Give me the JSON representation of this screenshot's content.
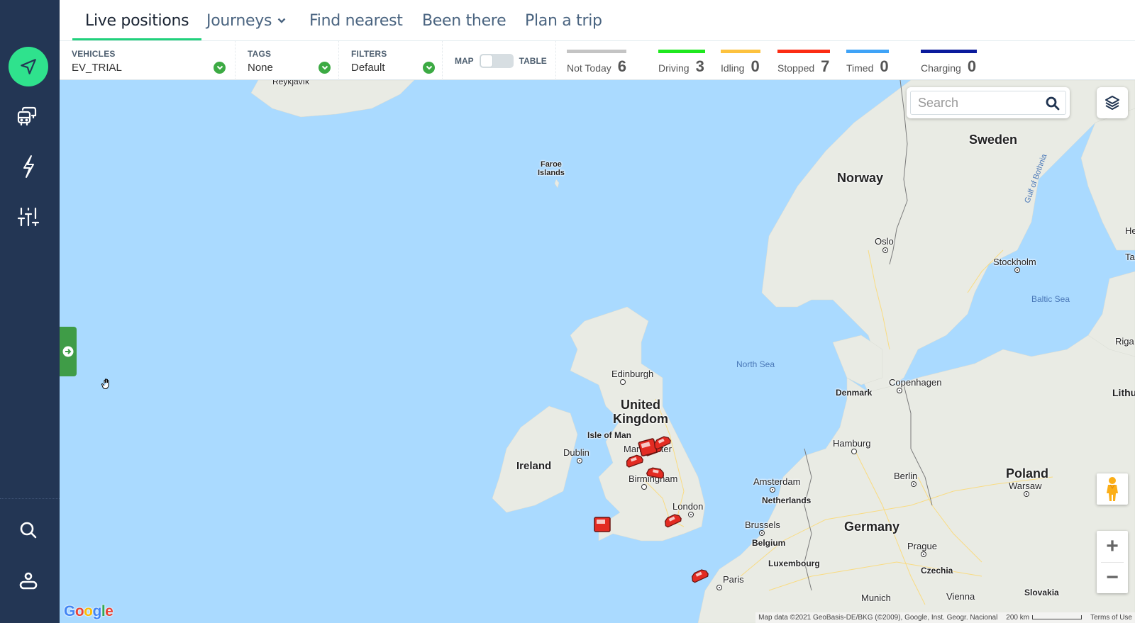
{
  "sidebar": {
    "items": [
      {
        "icon": "navigation-arrow-icon",
        "active": true
      },
      {
        "icon": "vehicles-icon",
        "active": false
      },
      {
        "icon": "lightning-icon",
        "active": false
      },
      {
        "icon": "sliders-icon",
        "active": false
      }
    ],
    "bottom_items": [
      {
        "icon": "search-icon"
      },
      {
        "icon": "user-icon"
      }
    ]
  },
  "topnav": {
    "tabs": [
      {
        "label": "Live positions",
        "active": true
      },
      {
        "label": "Journeys",
        "has_dropdown": true
      },
      {
        "label": "Find nearest"
      },
      {
        "label": "Been there"
      },
      {
        "label": "Plan a trip"
      }
    ],
    "dropdown_glyph": "⌄"
  },
  "filters": {
    "vehicles": {
      "label": "VEHICLES",
      "value": "EV_TRIAL"
    },
    "tags": {
      "label": "TAGS",
      "value": "None"
    },
    "filters": {
      "label": "FILTERS",
      "value": "Default"
    },
    "view_toggle": {
      "left": "MAP",
      "right": "TABLE",
      "selected": "MAP"
    }
  },
  "statuses": [
    {
      "label": "Not Today",
      "count": "6",
      "color": "#c4c4c4"
    },
    {
      "label": "Driving",
      "count": "3",
      "color": "#1ee81e"
    },
    {
      "label": "Idling",
      "count": "0",
      "color": "#fdc23e"
    },
    {
      "label": "Stopped",
      "count": "7",
      "color": "#fc2c13"
    },
    {
      "label": "Timed",
      "count": "0",
      "color": "#3fa3f7"
    },
    {
      "label": "Charging",
      "count": "0",
      "color": "#0a1a9c"
    }
  ],
  "map": {
    "search_placeholder": "Search",
    "places": {
      "reykjavik": "Reykjavík",
      "faroe": "Faroe\nIslands",
      "sweden": "Sweden",
      "norway": "Norway",
      "oslo": "Oslo",
      "stockholm": "Stockholm",
      "gulf_bothnia": "Gulf of Bothnia",
      "baltic": "Baltic Sea",
      "north_sea": "North Sea",
      "edinburgh": "Edinburgh",
      "uk": "United\nKingdom",
      "isle_of_man": "Isle of Man",
      "dublin": "Dublin",
      "ireland": "Ireland",
      "manchester": "Manchester",
      "birmingham": "Birmingham",
      "london": "London",
      "denmark": "Denmark",
      "copenhagen": "Copenhagen",
      "hamburg": "Hamburg",
      "berlin": "Berlin",
      "poland": "Poland",
      "warsaw": "Warsaw",
      "amsterdam": "Amsterdam",
      "netherlands": "Netherlands",
      "brussels": "Brussels",
      "belgium": "Belgium",
      "luxembourg": "Luxembourg",
      "germany": "Germany",
      "prague": "Prague",
      "czechia": "Czechia",
      "paris": "Paris",
      "munich": "Munich",
      "vienna": "Vienna",
      "slovakia": "Slovakia",
      "riga": "Riga",
      "lithuania": "Lithuan",
      "helsinki": "He",
      "tallinn": "Ta"
    },
    "vehicles": [
      {
        "name": "vehicle-marker",
        "type": "car",
        "status": "stopped"
      },
      {
        "name": "vehicle-marker",
        "type": "van",
        "status": "stopped"
      },
      {
        "name": "vehicle-marker",
        "type": "car",
        "status": "stopped"
      },
      {
        "name": "vehicle-marker",
        "type": "car",
        "status": "stopped"
      },
      {
        "name": "vehicle-marker",
        "type": "car",
        "status": "stopped"
      },
      {
        "name": "vehicle-marker",
        "type": "van",
        "status": "stopped"
      },
      {
        "name": "vehicle-marker",
        "type": "car",
        "status": "stopped"
      },
      {
        "name": "vehicle-marker",
        "type": "car",
        "status": "stopped"
      }
    ],
    "zoom_in": "+",
    "zoom_out": "−",
    "google_logo": "Google",
    "attribution": "Map data ©2021 GeoBasis-DE/BKG (©2009), Google, Inst. Geogr. Nacional",
    "scale_label": "200 km",
    "terms": "Terms of Use"
  }
}
